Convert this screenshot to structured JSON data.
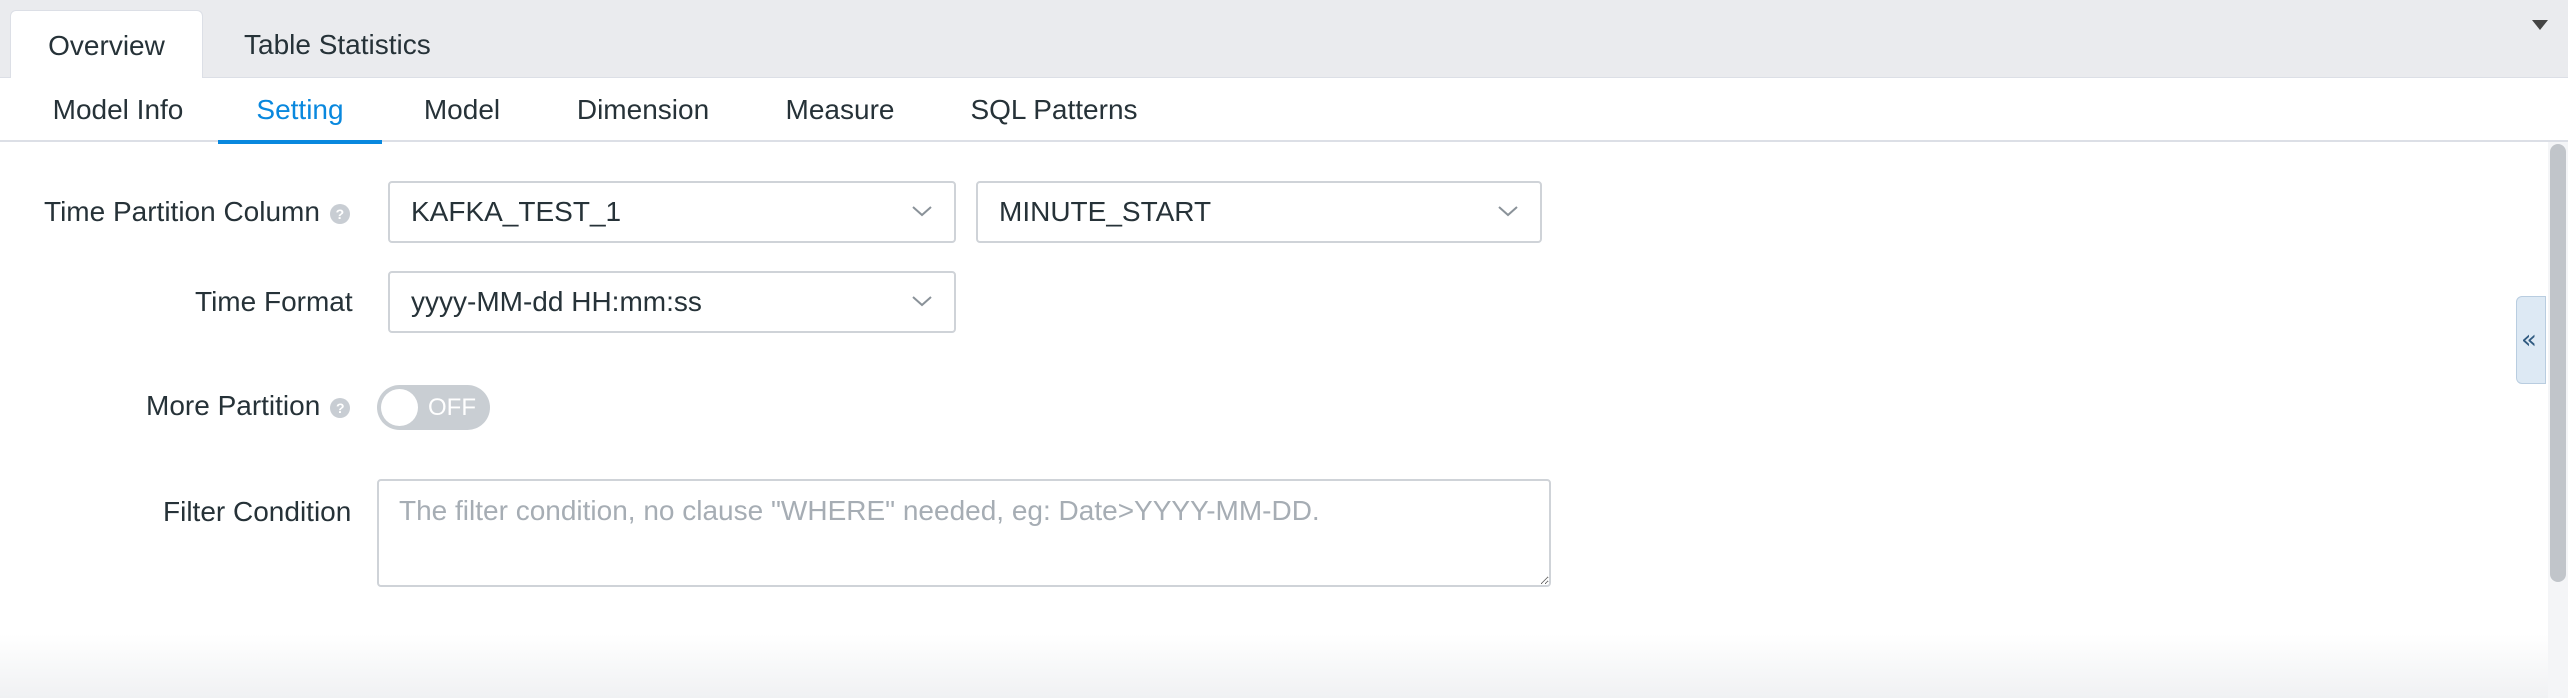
{
  "top_tabs": [
    {
      "label": "Overview",
      "active": true
    },
    {
      "label": "Table Statistics",
      "active": false
    }
  ],
  "sub_tabs": [
    {
      "label": "Model Info",
      "active": false
    },
    {
      "label": "Setting",
      "active": true
    },
    {
      "label": "Model",
      "active": false
    },
    {
      "label": "Dimension",
      "active": false
    },
    {
      "label": "Measure",
      "active": false
    },
    {
      "label": "SQL Patterns",
      "active": false
    }
  ],
  "form": {
    "partition_column_label": "Time Partition Column",
    "partition_table_value": "KAFKA_TEST_1",
    "partition_column_value": "MINUTE_START",
    "time_format_label": "Time Format",
    "time_format_value": "yyyy-MM-dd HH:mm:ss",
    "more_partition_label": "More Partition",
    "more_partition_toggle": "OFF",
    "filter_label": "Filter Condition",
    "filter_placeholder": "The filter condition, no clause \"WHERE\" needed, eg: Date>YYYY-MM-DD."
  },
  "colors": {
    "accent": "#0988de",
    "toggle_off": "#c9ced3",
    "tab_bar": "#eaebee"
  },
  "icons": {
    "help": "question-circle-icon",
    "select": "chevron-down-icon",
    "collapse": "double-chevron-left-icon",
    "tabs_menu": "caret-down-icon"
  }
}
